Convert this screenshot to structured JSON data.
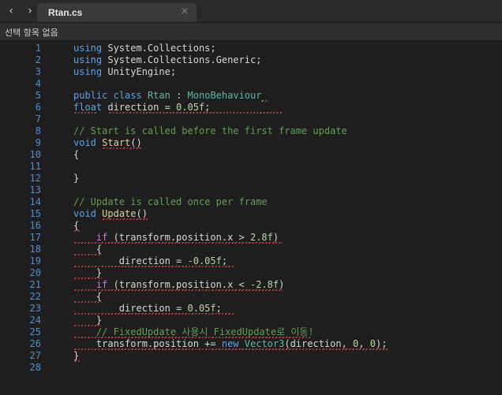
{
  "tab": {
    "title": "Rtan.cs",
    "close_label": "×"
  },
  "breadcrumb": "선택 항목 없음",
  "lines": [
    {
      "number": "1",
      "tokens": [
        {
          "text": "using",
          "kind": "kw"
        },
        {
          "text": " System.Collections;",
          "kind": "plain"
        }
      ]
    },
    {
      "number": "2",
      "tokens": [
        {
          "text": "using",
          "kind": "kw"
        },
        {
          "text": " System.Collections.Generic;",
          "kind": "plain"
        }
      ]
    },
    {
      "number": "3",
      "tokens": [
        {
          "text": "using",
          "kind": "kw"
        },
        {
          "text": " UnityEngine;",
          "kind": "plain"
        }
      ]
    },
    {
      "number": "4",
      "tokens": []
    },
    {
      "number": "5",
      "tokens": [
        {
          "text": "public",
          "kind": "kw"
        },
        {
          "text": " ",
          "kind": "plain"
        },
        {
          "text": "class",
          "kind": "kw"
        },
        {
          "text": " ",
          "kind": "plain"
        },
        {
          "text": "Rtan",
          "kind": "cls"
        },
        {
          "text": " : ",
          "kind": "plain"
        },
        {
          "text": "MonoBehaviour",
          "kind": "cls"
        }
      ]
    },
    {
      "number": "6",
      "tokens": [
        {
          "text": "float",
          "kind": "kw"
        },
        {
          "text": " direction = ",
          "kind": "plain"
        },
        {
          "text": "0.05f",
          "kind": "num"
        },
        {
          "text": ";",
          "kind": "plain"
        }
      ]
    },
    {
      "number": "7",
      "tokens": []
    },
    {
      "number": "8",
      "tokens": [
        {
          "text": "// Start is called before the first frame update",
          "kind": "comment"
        }
      ]
    },
    {
      "number": "9",
      "tokens": [
        {
          "text": "void",
          "kind": "kw"
        },
        {
          "text": " ",
          "kind": "plain"
        },
        {
          "text": "Start",
          "kind": "method"
        },
        {
          "text": "()",
          "kind": "plain"
        }
      ]
    },
    {
      "number": "10",
      "tokens": [
        {
          "text": "{",
          "kind": "plain"
        }
      ]
    },
    {
      "number": "11",
      "tokens": []
    },
    {
      "number": "12",
      "tokens": [
        {
          "text": "}",
          "kind": "plain"
        }
      ]
    },
    {
      "number": "13",
      "tokens": []
    },
    {
      "number": "14",
      "tokens": [
        {
          "text": "// Update is called once per frame",
          "kind": "comment"
        }
      ]
    },
    {
      "number": "15",
      "tokens": [
        {
          "text": "void",
          "kind": "kw"
        },
        {
          "text": " ",
          "kind": "plain"
        },
        {
          "text": "Update",
          "kind": "method"
        },
        {
          "text": "()",
          "kind": "plain"
        }
      ]
    },
    {
      "number": "16",
      "tokens": [
        {
          "text": "{",
          "kind": "plain"
        }
      ]
    },
    {
      "number": "17",
      "tokens": [
        {
          "text": "    ",
          "kind": "plain"
        },
        {
          "text": "if",
          "kind": "kw-purple"
        },
        {
          "text": " (transform.position.x > ",
          "kind": "plain"
        },
        {
          "text": "2.8f",
          "kind": "num"
        },
        {
          "text": ")",
          "kind": "plain"
        }
      ]
    },
    {
      "number": "18",
      "tokens": [
        {
          "text": "    {",
          "kind": "plain"
        }
      ]
    },
    {
      "number": "19",
      "tokens": [
        {
          "text": "        direction = ",
          "kind": "plain"
        },
        {
          "text": "-0.05f",
          "kind": "num"
        },
        {
          "text": ";",
          "kind": "plain"
        }
      ]
    },
    {
      "number": "20",
      "tokens": [
        {
          "text": "    }",
          "kind": "plain"
        }
      ]
    },
    {
      "number": "21",
      "tokens": [
        {
          "text": "    ",
          "kind": "plain"
        },
        {
          "text": "if",
          "kind": "kw-purple"
        },
        {
          "text": " (transform.position.x < ",
          "kind": "plain"
        },
        {
          "text": "-2.8f",
          "kind": "num"
        },
        {
          "text": ")",
          "kind": "plain"
        }
      ]
    },
    {
      "number": "22",
      "tokens": [
        {
          "text": "    {",
          "kind": "plain"
        }
      ]
    },
    {
      "number": "23",
      "tokens": [
        {
          "text": "        direction = ",
          "kind": "plain"
        },
        {
          "text": "0.05f",
          "kind": "num"
        },
        {
          "text": ";",
          "kind": "plain"
        }
      ]
    },
    {
      "number": "24",
      "tokens": [
        {
          "text": "    }",
          "kind": "plain"
        }
      ]
    },
    {
      "number": "25",
      "tokens": [
        {
          "text": "    ",
          "kind": "plain"
        },
        {
          "text": "// FixedUpdate 사용시 FixedUpdate로 이동!",
          "kind": "comment"
        }
      ]
    },
    {
      "number": "26",
      "tokens": [
        {
          "text": "    transform.position += ",
          "kind": "plain"
        },
        {
          "text": "new",
          "kind": "kw"
        },
        {
          "text": " ",
          "kind": "plain"
        },
        {
          "text": "Vector3",
          "kind": "cls"
        },
        {
          "text": "(direction, ",
          "kind": "plain"
        },
        {
          "text": "0",
          "kind": "num"
        },
        {
          "text": ", ",
          "kind": "plain"
        },
        {
          "text": "0",
          "kind": "num"
        },
        {
          "text": ");",
          "kind": "plain"
        }
      ]
    },
    {
      "number": "27",
      "tokens": [
        {
          "text": "}",
          "kind": "plain"
        }
      ]
    },
    {
      "number": "28",
      "tokens": []
    }
  ]
}
